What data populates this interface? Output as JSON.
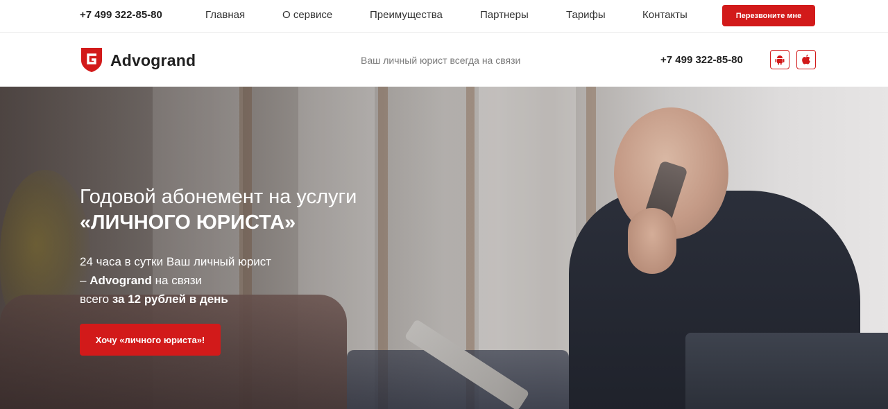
{
  "topbar": {
    "phone": "+7 499 322-85-80",
    "nav": [
      "Главная",
      "О сервисе",
      "Преимущества",
      "Партнеры",
      "Тарифы",
      "Контакты"
    ],
    "callback_label": "Перезвоните мне"
  },
  "header": {
    "logo_text": "Advogrand",
    "tagline": "Ваш личный юрист всегда на связи",
    "phone": "+7 499 322-85-80",
    "app_icons": [
      "android-icon",
      "apple-icon"
    ]
  },
  "hero": {
    "title_line1": "Годовой абонемент на услуги",
    "title_line2": "«ЛИЧНОГО ЮРИСТА»",
    "line1": "24 часа в сутки Ваш личный юрист",
    "line2_prefix": "– ",
    "line2_bold": "Advogrand",
    "line2_suffix": " на связи",
    "line3_prefix": "всего ",
    "line3_bold": "за 12 рублей в день",
    "cta_label": "Хочу «личного юриста»!"
  },
  "colors": {
    "accent": "#d21a1a",
    "text": "#222222",
    "muted": "#7a7a7a"
  }
}
